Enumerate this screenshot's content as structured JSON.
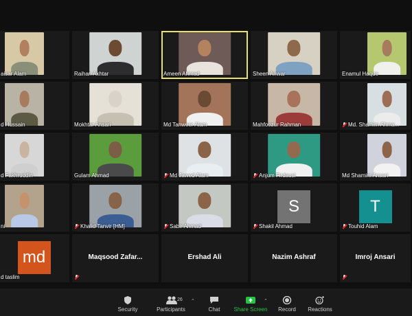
{
  "participants": [
    {
      "name": "aisar Alam",
      "type": "video",
      "bg": "#d7c9a6",
      "skin": "#b08060",
      "shirt": "#8a8f7a",
      "muted": false,
      "pos": "edge-left"
    },
    {
      "name": "Raihan Akhtar",
      "type": "video",
      "bg": "#cfd4d2",
      "skin": "#6d4b33",
      "shirt": "#2d2d30",
      "muted": false
    },
    {
      "name": "Ameen Ahmad",
      "type": "video",
      "bg": "#6e5a57",
      "skin": "#b3825f",
      "shirt": "#e8e4dd",
      "muted": false,
      "active": true
    },
    {
      "name": "Sheen Anwar",
      "type": "video",
      "bg": "#d6d1c3",
      "skin": "#8e6a4c",
      "shirt": "#7fa2c2",
      "muted": false
    },
    {
      "name": "Enamul Haque",
      "type": "video",
      "bg": "#b6c86f",
      "skin": "#a77c5e",
      "shirt": "#f0f0ec",
      "muted": false,
      "pos": "edge-right"
    },
    {
      "name": "d Hussain",
      "type": "video",
      "bg": "#b9b3a5",
      "skin": "#a67c5c",
      "shirt": "#5c5a45",
      "muted": false,
      "pos": "edge-left"
    },
    {
      "name": "Mokhtar Ansari",
      "type": "video",
      "bg": "#e6e1d7",
      "skin": "#d8d2c7",
      "shirt": "#c6c0b3",
      "muted": false
    },
    {
      "name": "Md Tanweer Alam",
      "type": "video",
      "bg": "#a4745a",
      "skin": "#6b4a35",
      "shirt": "#f0f0f0",
      "muted": false
    },
    {
      "name": "Mahfoozur Rahman",
      "type": "video",
      "bg": "#c6b7a6",
      "skin": "#a8735a",
      "shirt": "#9c3c3a",
      "muted": false
    },
    {
      "name": "Md. Shamim Ahma...",
      "type": "video",
      "bg": "#d8dfe2",
      "skin": "#9b6e55",
      "shirt": "#ececec",
      "muted": true,
      "pos": "edge-right"
    },
    {
      "name": "d Fakhruddin",
      "type": "video",
      "bg": "#d7d7d7",
      "skin": "#c9b4a2",
      "shirt": "#cfcfcf",
      "muted": false,
      "pos": "edge-left"
    },
    {
      "name": "Gulam Ahmad",
      "type": "video",
      "bg": "#5b9c3d",
      "skin": "#7c5d45",
      "shirt": "#4a4a4a",
      "muted": false
    },
    {
      "name": "Md Jawed Alam",
      "type": "video",
      "bg": "#dfe2e4",
      "skin": "#8a6348",
      "shirt": "#e9eef3",
      "muted": true
    },
    {
      "name": "Anjum Firdausi",
      "type": "video",
      "bg": "#2f9a83",
      "skin": "#936a4d",
      "shirt": "#f1f1f1",
      "muted": true
    },
    {
      "name": "Md Shamim Ansari",
      "type": "video",
      "bg": "#d1d3dc",
      "skin": "#8e6448",
      "shirt": "#f2f2f2",
      "muted": false,
      "pos": "edge-right"
    },
    {
      "name": "ni",
      "type": "video",
      "bg": "#b4a38c",
      "skin": "#c4936e",
      "shirt": "#b9c8e6",
      "muted": false,
      "pos": "edge-left"
    },
    {
      "name": "Khalid Tanvir [HM]",
      "type": "video",
      "bg": "#9aa2a8",
      "skin": "#876449",
      "shirt": "#3a5d92",
      "muted": true
    },
    {
      "name": "Sabir Ahmad",
      "type": "video",
      "bg": "#c3c8c2",
      "skin": "#8c6448",
      "shirt": "#dadde6",
      "muted": true
    },
    {
      "name": "Shakil Ahmad",
      "type": "initial",
      "letter": "S",
      "initial_bg": "#737373",
      "muted": true
    },
    {
      "name": "Touhid Alam",
      "type": "initial",
      "letter": "T",
      "initial_bg": "#13908f",
      "muted": true,
      "pos": "edge-right"
    },
    {
      "name": "d taslim",
      "type": "initial",
      "letter": "md",
      "initial_bg": "#d4541e",
      "muted": false,
      "pos": "edge-left"
    },
    {
      "name": "Maqsood  Zafar...",
      "type": "nameonly",
      "muted": true
    },
    {
      "name": "Ershad Ali",
      "type": "nameonly",
      "muted": false
    },
    {
      "name": "Nazim Ashraf",
      "type": "nameonly",
      "muted": false
    },
    {
      "name": "Imroj Ansari",
      "type": "nameonly",
      "muted": true,
      "pos": "edge-right"
    }
  ],
  "toolbar": {
    "security": {
      "label": "Security",
      "icon": "shield-icon"
    },
    "participants": {
      "label": "Participants",
      "icon": "participants-icon",
      "count": "26"
    },
    "chat": {
      "label": "Chat",
      "icon": "chat-icon"
    },
    "share": {
      "label": "Share Screen",
      "icon": "share-screen-icon",
      "color": "#25c444"
    },
    "record": {
      "label": "Record",
      "icon": "record-icon"
    },
    "reactions": {
      "label": "Reactions",
      "icon": "reactions-icon"
    }
  }
}
